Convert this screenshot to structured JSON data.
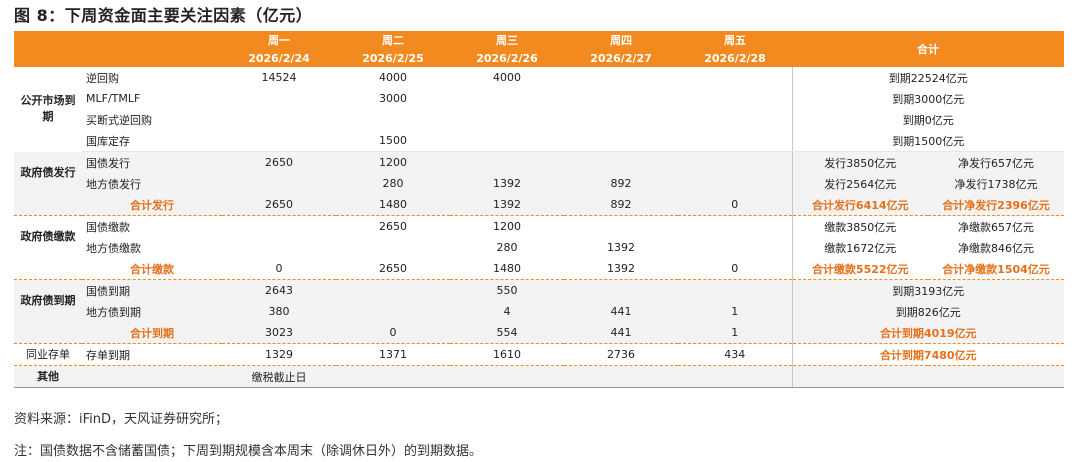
{
  "title": "图 8：下周资金面主要关注因素（亿元）",
  "header": {
    "days": [
      {
        "name": "周一",
        "date": "2026/2/24"
      },
      {
        "name": "周二",
        "date": "2026/2/25"
      },
      {
        "name": "周三",
        "date": "2026/2/26"
      },
      {
        "name": "周四",
        "date": "2026/2/27"
      },
      {
        "name": "周五",
        "date": "2026/2/28"
      }
    ],
    "total": "合计"
  },
  "groups": {
    "open_market": "公开市场到期",
    "gov_issue": "政府债发行",
    "gov_pay": "政府债缴款",
    "gov_maturity": "政府债到期",
    "interbank": "同业存单",
    "other": "其他"
  },
  "rows": {
    "reverse_repo": {
      "label": "逆回购",
      "v": [
        "14524",
        "4000",
        "4000",
        "",
        ""
      ],
      "total": "到期22524亿元"
    },
    "mlf": {
      "label": "MLF/TMLF",
      "v": [
        "",
        "3000",
        "",
        "",
        ""
      ],
      "total": "到期3000亿元"
    },
    "outright": {
      "label": "买断式逆回购",
      "v": [
        "",
        "",
        "",
        "",
        ""
      ],
      "total": "到期0亿元"
    },
    "treasury_deposit": {
      "label": "国库定存",
      "v": [
        "",
        "1500",
        "",
        "",
        ""
      ],
      "total": "到期1500亿元"
    },
    "ng_issue": {
      "label": "国债发行",
      "v": [
        "2650",
        "1200",
        "",
        "",
        ""
      ],
      "t1": "发行3850亿元",
      "t2": "净发行657亿元"
    },
    "lg_issue": {
      "label": "地方债发行",
      "v": [
        "",
        "280",
        "1392",
        "892",
        ""
      ],
      "t1": "发行2564亿元",
      "t2": "净发行1738亿元"
    },
    "issue_sum": {
      "label": "合计发行",
      "v": [
        "2650",
        "1480",
        "1392",
        "892",
        "0"
      ],
      "t1": "合计发行6414亿元",
      "t2": "合计净发行2396亿元"
    },
    "ng_pay": {
      "label": "国债缴款",
      "v": [
        "",
        "2650",
        "1200",
        "",
        ""
      ],
      "t1": "缴款3850亿元",
      "t2": "净缴款657亿元"
    },
    "lg_pay": {
      "label": "地方债缴款",
      "v": [
        "",
        "",
        "280",
        "1392",
        ""
      ],
      "t1": "缴款1672亿元",
      "t2": "净缴款846亿元"
    },
    "pay_sum": {
      "label": "合计缴款",
      "v": [
        "0",
        "2650",
        "1480",
        "1392",
        "0"
      ],
      "t1": "合计缴款5522亿元",
      "t2": "合计净缴款1504亿元"
    },
    "ng_mat": {
      "label": "国债到期",
      "v": [
        "2643",
        "",
        "550",
        "",
        ""
      ],
      "total": "到期3193亿元"
    },
    "lg_mat": {
      "label": "地方债到期",
      "v": [
        "380",
        "",
        "4",
        "441",
        "1"
      ],
      "total": "到期826亿元"
    },
    "mat_sum": {
      "label": "合计到期",
      "v": [
        "3023",
        "0",
        "554",
        "441",
        "1"
      ],
      "total": "合计到期4019亿元"
    },
    "cd": {
      "label": "存单到期",
      "v": [
        "1329",
        "1371",
        "1610",
        "2736",
        "434"
      ],
      "total": "合计到期7480亿元"
    },
    "other": {
      "note": "缴税截止日"
    }
  },
  "footer": {
    "source": "资料来源：iFinD，天风证券研究所；",
    "note": "注：国债数据不含储蓄国债；下周到期规模含本周末（除调休日外）的到期数据。"
  }
}
